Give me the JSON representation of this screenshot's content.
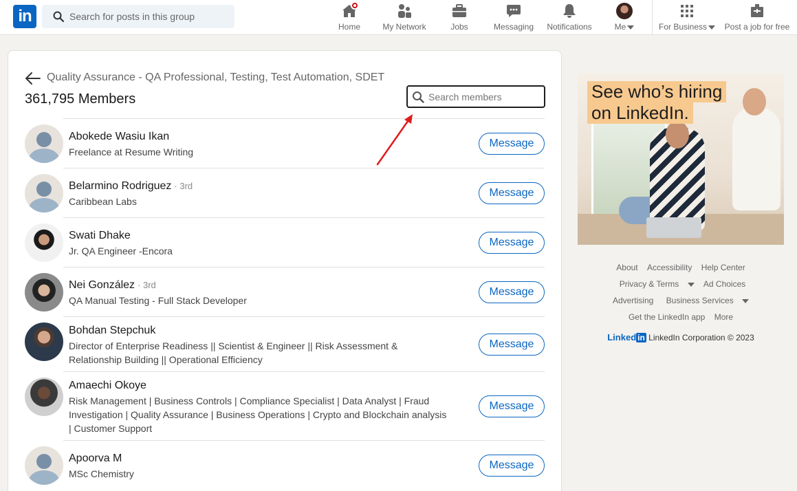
{
  "nav": {
    "logo_text": "in",
    "search_placeholder": "Search for posts in this group",
    "items": [
      {
        "label": "Home"
      },
      {
        "label": "My Network"
      },
      {
        "label": "Jobs"
      },
      {
        "label": "Messaging"
      },
      {
        "label": "Notifications"
      },
      {
        "label": "Me"
      },
      {
        "label": "For Business"
      },
      {
        "label": "Post a job for free"
      }
    ]
  },
  "group": {
    "title": "Quality Assurance - QA Professional, Testing, Test Automation, SDET",
    "member_count": "361,795 Members",
    "search_placeholder": "Search members"
  },
  "members": [
    {
      "name": "Abokede Wasiu Ikan",
      "degree": "",
      "headline": "Freelance at Resume Writing",
      "button": "Message"
    },
    {
      "name": "Belarmino Rodriguez",
      "degree": "· 3rd",
      "headline": "Caribbean Labs",
      "button": "Message"
    },
    {
      "name": "Swati Dhake",
      "degree": "",
      "headline": "Jr. QA Engineer -Encora",
      "button": "Message"
    },
    {
      "name": "Nei González",
      "degree": "· 3rd",
      "headline": "QA Manual Testing - Full Stack Developer",
      "button": "Message"
    },
    {
      "name": "Bohdan Stepchuk",
      "degree": "",
      "headline": "Director of Enterprise Readiness || Scientist & Engineer || Risk Assessment & Relationship Building || Operational Efficiency",
      "button": "Message"
    },
    {
      "name": "Amaechi Okoye",
      "degree": "",
      "headline": "Risk Management | Business Controls | Compliance Specialist | Data Analyst | Fraud Investigation | Quality Assurance | Business Operations | Crypto and Blockchain analysis | Customer Support",
      "button": "Message"
    },
    {
      "name": "Apoorva M",
      "degree": "",
      "headline": "MSc Chemistry",
      "button": "Message"
    }
  ],
  "ad": {
    "line1": "See who’s hiring",
    "line2": "on LinkedIn."
  },
  "footer": {
    "row1": [
      "About",
      "Accessibility",
      "Help Center"
    ],
    "row2": [
      "Privacy & Terms",
      "Ad Choices"
    ],
    "row3": [
      "Advertising",
      "Business Services"
    ],
    "row4": [
      "Get the LinkedIn app",
      "More"
    ],
    "brand_word": "Linked",
    "brand_in": "in",
    "copyright": "LinkedIn Corporation © 2023"
  },
  "colors": {
    "brand": "#0a66c2",
    "annotation_arrow": "#e01b1b",
    "notification_badge": "#cc1016"
  },
  "icons": [
    "search-icon",
    "home-icon",
    "my-network-icon",
    "jobs-icon",
    "messaging-icon",
    "notifications-icon",
    "grid-icon",
    "post-job-icon",
    "back-arrow-icon"
  ]
}
